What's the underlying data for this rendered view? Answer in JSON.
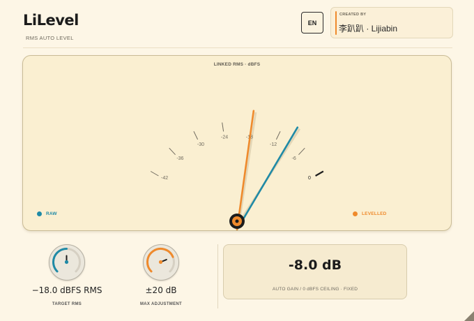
{
  "header": {
    "title": "LiLevel",
    "subtitle": "RMS AUTO LEVEL",
    "language_button": "EN",
    "credit_label": "CREATED BY",
    "credit_name": "李趴趴 · Lijiabin"
  },
  "meter": {
    "label": "LINKED RMS · dBFS",
    "scale": [
      "-42",
      "-36",
      "-30",
      "-24",
      "-18",
      "-12",
      "-6",
      "0"
    ],
    "raw_needle_dbfs": -9.5,
    "levelled_needle_dbfs": -18,
    "legend": [
      {
        "name": "RAW",
        "color": "#1f8aa6"
      },
      {
        "name": "LEVELLED",
        "color": "#ef8a2c"
      }
    ]
  },
  "controls": {
    "target": {
      "value": "−18.0 dBFS RMS",
      "label": "TARGET RMS",
      "color": "#1f8aa6",
      "fill": 0.5
    },
    "max_adjustment": {
      "value": "±20 dB",
      "label": "MAX ADJUSTMENT",
      "color": "#ef8a2c",
      "fill": 0.75
    }
  },
  "gain": {
    "value": "-8.0 dB",
    "note": "AUTO GAIN / 0 dBFS CEILING · FIXED"
  },
  "colors": {
    "raw": "#1f8aa6",
    "levelled": "#ef8a2c",
    "panel": "#faefd1",
    "background": "#fdf6e6"
  }
}
